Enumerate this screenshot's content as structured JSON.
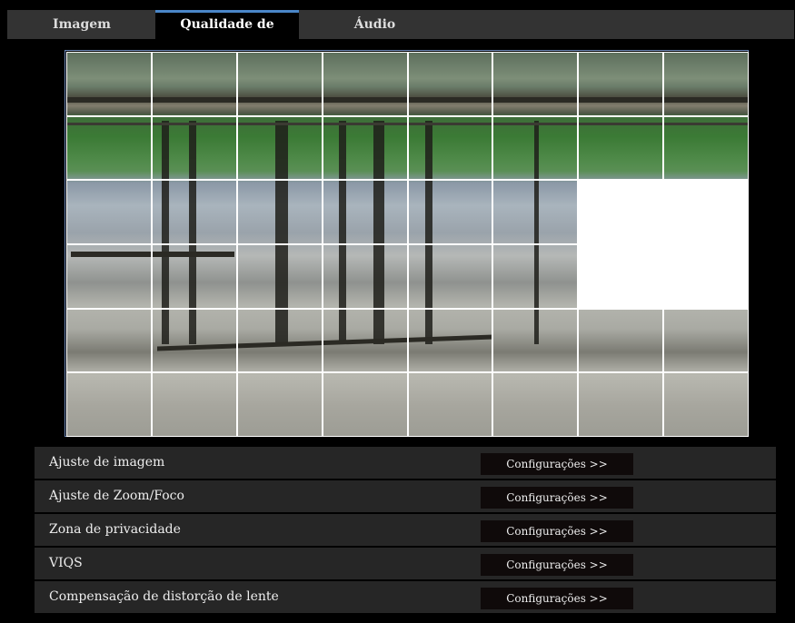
{
  "tabs": [
    {
      "label": "Imagem",
      "active": false
    },
    {
      "label": "Qualidade de imagem",
      "active": true
    },
    {
      "label": "Áudio",
      "active": false
    }
  ],
  "privacy_grid": {
    "columns": 8,
    "rows": 6,
    "masked_cells": [
      [
        2,
        6
      ],
      [
        2,
        7
      ],
      [
        3,
        6
      ],
      [
        3,
        7
      ]
    ]
  },
  "settings": [
    {
      "label": "Ajuste de imagem",
      "button": "Configurações >>"
    },
    {
      "label": "Ajuste de Zoom/Foco",
      "button": "Configurações >>"
    },
    {
      "label": "Zona de privacidade",
      "button": "Configurações >>"
    },
    {
      "label": "VIQS",
      "button": "Configurações >>"
    },
    {
      "label": "Compensação de distorção de lente",
      "button": "Configurações >>"
    }
  ],
  "colors": {
    "tab_bar": "#333333",
    "row_bg": "#262626",
    "button_bg": "#0f0a0a",
    "grid_border": "#6b86b5"
  }
}
